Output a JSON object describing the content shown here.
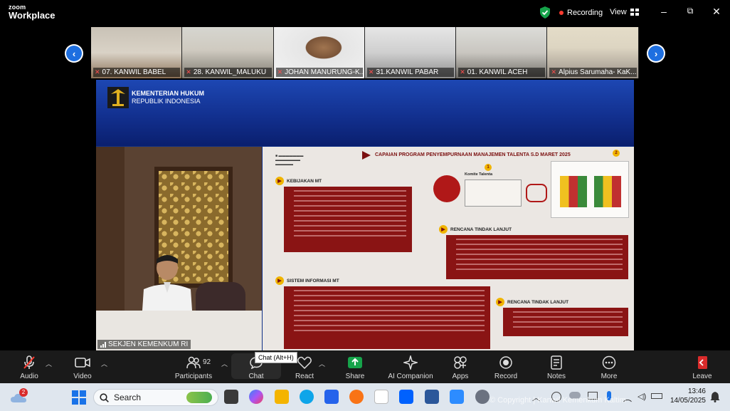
{
  "app": {
    "brand_top": "zoom",
    "brand_bottom": "Workplace"
  },
  "status": {
    "recording": "Recording",
    "view": "View"
  },
  "window_controls": {
    "minimize": "–",
    "restore": "⧉",
    "close": "✕"
  },
  "participants_strip": [
    {
      "name": "07. KANWIL BABEL"
    },
    {
      "name": "28. KANWIL_MALUKU"
    },
    {
      "name": "JOHAN MANURUNG-K..."
    },
    {
      "name": "31.KANWIL PABAR"
    },
    {
      "name": "01. KANWIL ACEH"
    },
    {
      "name": "Alpius Sarumaha- KaK..."
    }
  ],
  "shared_screen": {
    "ministry_line1": "KEMENTERIAN HUKUM",
    "ministry_line2": "REPUBLIK INDONESIA",
    "speaker_label": "SEKJEN KEMENKUM RI",
    "slide": {
      "title": "CAPAIAN PROGRAM PENYEMPURNAAN MANAJEMEN TALENTA S.D MARET 2025",
      "page": "2",
      "badge": "1",
      "sections": [
        "KEBIJAKAN MT",
        "RENCANA TINDAK LANJUT",
        "SISTEM INFORMASI MT",
        "RENCANA TINDAK LANJUT"
      ],
      "komite": "Komite Talenta"
    }
  },
  "toolbar": {
    "audio": "Audio",
    "video": "Video",
    "participants": "Participants",
    "participants_count": "92",
    "chat": "Chat",
    "chat_tooltip": "Chat (Alt+H)",
    "react": "React",
    "share": "Share",
    "ai_companion": "AI Companion",
    "apps": "Apps",
    "record": "Record",
    "notes": "Notes",
    "more": "More",
    "leave": "Leave"
  },
  "taskbar": {
    "search_placeholder": "Search",
    "notification_count": "2",
    "time": "13:46",
    "date": "14/05/2025",
    "watermark": "© Copyright | Kanwil Kemenkum Kaltim"
  },
  "colors": {
    "accent": "#1e6fe0",
    "record_red": "#ff3b30",
    "slide_red": "#8a1414",
    "share_green": "#16a34a"
  }
}
